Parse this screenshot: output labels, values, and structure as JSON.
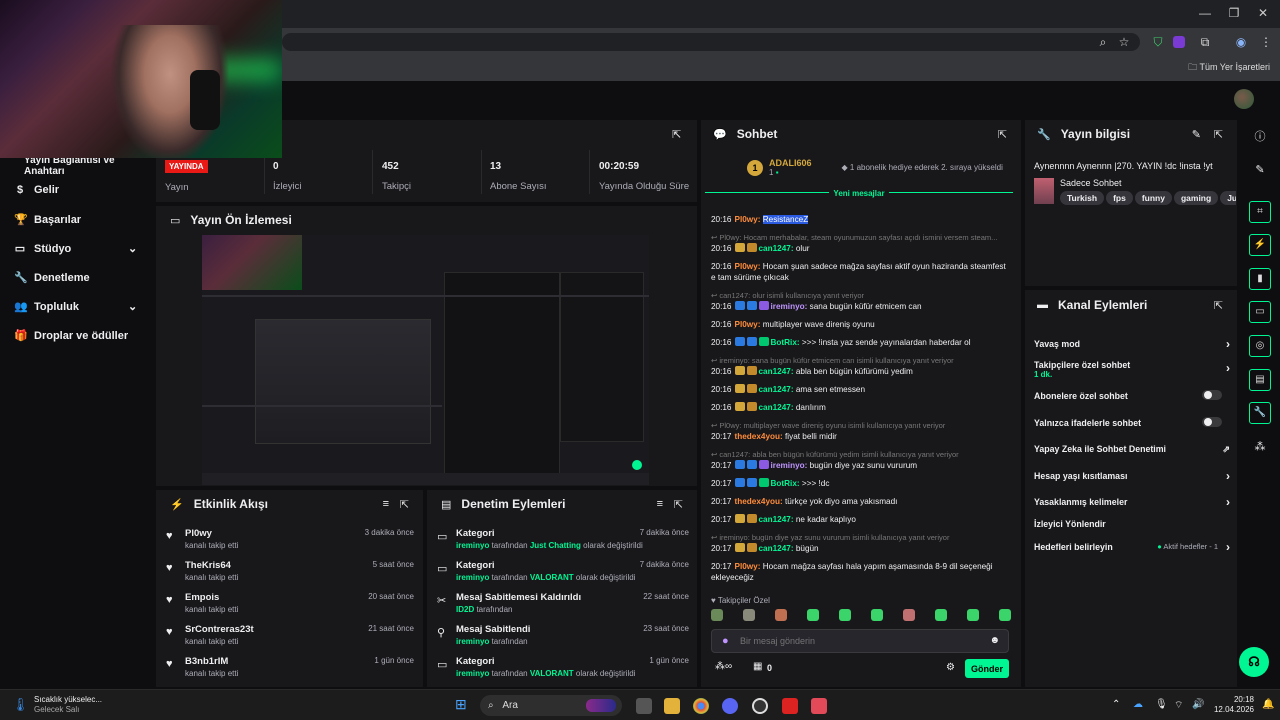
{
  "browser": {
    "bookmarks_label": "Tüm Yer İşaretleri"
  },
  "sidebar": {
    "partial_title": "Yayın Bağlantısı ve Anahtarı",
    "items": [
      {
        "label": "Gelir",
        "icon": "dollar-icon"
      },
      {
        "label": "Başarılar",
        "icon": "trophy-icon"
      },
      {
        "label": "Stüdyo",
        "icon": "studio-icon"
      },
      {
        "label": "Denetleme",
        "icon": "wrench-icon"
      },
      {
        "label": "Topluluk",
        "icon": "users-icon"
      },
      {
        "label": "Droplar ve ödüller",
        "icon": "gift-icon"
      }
    ]
  },
  "stats": {
    "live_badge": "YAYINDA",
    "live_label": "Yayın",
    "viewers_value": "0",
    "viewers_label": "İzleyici",
    "followers_value": "452",
    "followers_label": "Takipçi",
    "subs_value": "13",
    "subs_label": "Abone Sayısı",
    "uptime_value": "00:20:59",
    "uptime_label": "Yayında Olduğu Süre"
  },
  "preview": {
    "title": "Yayın Ön İzlemesi"
  },
  "activity": {
    "title": "Etkinlik Akışı",
    "items": [
      {
        "name": "Pl0wy",
        "sub": "kanalı takip etti",
        "time": "3 dakika önce"
      },
      {
        "name": "TheKris64",
        "sub": "kanalı takip etti",
        "time": "5 saat önce"
      },
      {
        "name": "Empois",
        "sub": "kanalı takip etti",
        "time": "20 saat önce"
      },
      {
        "name": "SrContreras23t",
        "sub": "kanalı takip etti",
        "time": "21 saat önce"
      },
      {
        "name": "B3nb1rIM",
        "sub": "kanalı takip etti",
        "time": "1 gün önce"
      }
    ]
  },
  "moderation": {
    "title": "Denetim Eylemleri",
    "items": [
      {
        "name": "Kategori",
        "user": "ireminyo",
        "mid": " tarafından ",
        "hl": "Just Chatting",
        "end": " olarak değiştirildi",
        "time": "7 dakika önce"
      },
      {
        "name": "Kategori",
        "user": "ireminyo",
        "mid": " tarafından ",
        "hl": "VALORANT",
        "end": " olarak değiştirildi",
        "time": "7 dakika önce"
      },
      {
        "name": "Mesaj Sabitlemesi Kaldırıldı",
        "user": "ID2D",
        "mid": " tarafından",
        "hl": "",
        "end": "",
        "time": "22 saat önce"
      },
      {
        "name": "Mesaj Sabitlendi",
        "user": "ireminyo",
        "mid": " tarafından",
        "hl": "",
        "end": "",
        "time": "23 saat önce"
      },
      {
        "name": "Kategori",
        "user": "ireminyo",
        "mid": " tarafından ",
        "hl": "VALORANT",
        "end": " olarak değiştirildi",
        "time": "1 gün önce"
      }
    ]
  },
  "chat": {
    "title": "Sohbet",
    "hype_user": "ADALI606",
    "hype_level": "1",
    "hype_count": "1",
    "hype_text": "1 abonelik hediye ederek 2. sıraya yükseldi",
    "new_messages": "Yeni mesajlar",
    "followers_only": "Takipçiler Özel",
    "input_placeholder": "Bir mesaj gönderin",
    "points": "0",
    "send": "Gönder",
    "messages": [
      {
        "reply": "",
        "ts": "20:16",
        "user": "Pl0wy",
        "color": "#ff8c3a",
        "badges": [],
        "text": "",
        "hl": "ResistanceZ"
      },
      {
        "reply": "Pl0wy: Hocam merhabalar, steam oyunumuzun sayfası açıdı ismini versem steam...",
        "ts": "20:16",
        "user": "can1247",
        "color": "#00f593",
        "badges": [
          "#d4a73a",
          "#c28a2a"
        ],
        "text": "olur"
      },
      {
        "reply": "",
        "ts": "20:16",
        "user": "Pl0wy",
        "color": "#ff8c3a",
        "badges": [],
        "text": "Hocam şuan sadece mağza sayfası aktif oyun haziranda steamfest e tam sürüme çıkıcak"
      },
      {
        "reply": "can1247: olur isimli kullanıcıya yanıt veriyor",
        "ts": "20:16",
        "user": "ireminyo",
        "color": "#bf94ff",
        "badges": [
          "#2a7ae2",
          "#2a7ae2",
          "#8a5ae2"
        ],
        "text": "sana bugün küfür etmicem can"
      },
      {
        "reply": "",
        "ts": "20:16",
        "user": "Pl0wy",
        "color": "#ff8c3a",
        "badges": [],
        "text": "multiplayer wave direniş oyunu"
      },
      {
        "reply": "",
        "ts": "20:16",
        "user": "BotRix",
        "color": "#00f593",
        "badges": [
          "#2a7ae2",
          "#2a7ae2",
          "#00c86e"
        ],
        "text": ">>> !insta yaz sende yayınalardan haberdar ol"
      },
      {
        "reply": "ireminyo: sana bugün küfür etmicem can isimli kullanıcıya yanıt veriyor",
        "ts": "20:16",
        "user": "can1247",
        "color": "#00f593",
        "badges": [
          "#d4a73a",
          "#c28a2a"
        ],
        "text": "abla ben bügün küfürümü yedim"
      },
      {
        "reply": "",
        "ts": "20:16",
        "user": "can1247",
        "color": "#00f593",
        "badges": [
          "#d4a73a",
          "#c28a2a"
        ],
        "text": "ama sen etmessen"
      },
      {
        "reply": "",
        "ts": "20:16",
        "user": "can1247",
        "color": "#00f593",
        "badges": [
          "#d4a73a",
          "#c28a2a"
        ],
        "text": "darılırım"
      },
      {
        "reply": "Pl0wy: multiplayer wave direniş oyunu isimli kullanıcıya yanıt veriyor",
        "ts": "20:17",
        "user": "thedex4you",
        "color": "#ff8c3a",
        "badges": [],
        "text": "fiyat belli midir"
      },
      {
        "reply": "can1247: abla ben bügün küfürümü yedim isimli kullanıcıya yanıt veriyor",
        "ts": "20:17",
        "user": "ireminyo",
        "color": "#bf94ff",
        "badges": [
          "#2a7ae2",
          "#2a7ae2",
          "#8a5ae2"
        ],
        "text": "bugün diye yaz sunu vururum"
      },
      {
        "reply": "",
        "ts": "20:17",
        "user": "BotRix",
        "color": "#00f593",
        "badges": [
          "#2a7ae2",
          "#2a7ae2",
          "#00c86e"
        ],
        "text": ">>> !dc"
      },
      {
        "reply": "",
        "ts": "20:17",
        "user": "thedex4you",
        "color": "#ff8c3a",
        "badges": [],
        "text": "türkçe yok diyo ama yakısmadı"
      },
      {
        "reply": "",
        "ts": "20:17",
        "user": "can1247",
        "color": "#00f593",
        "badges": [
          "#d4a73a",
          "#c28a2a"
        ],
        "text": "ne kadar kaplıyo"
      },
      {
        "reply": "ireminyo: bugün diye yaz sunu vururum isimli kullanıcıya yanıt veriyor",
        "ts": "20:17",
        "user": "can1247",
        "color": "#00f593",
        "badges": [
          "#d4a73a",
          "#c28a2a"
        ],
        "text": "bügün"
      },
      {
        "reply": "",
        "ts": "20:17",
        "user": "Pl0wy",
        "color": "#ff8c3a",
        "badges": [],
        "text": "Hocam mağza sayfası hala yapım aşamasında 8-9 dil seçeneği ekleyeceğiz"
      }
    ]
  },
  "stream_info": {
    "title": "Yayın bilgisi",
    "stream_title": "Aynennnn Aynennn |270. YAYIN !dc !insta !yt",
    "category": "Sadece Sohbet",
    "tags": [
      "Turkish",
      "fps",
      "funny",
      "gaming",
      "Just"
    ]
  },
  "channel_actions": {
    "title": "Kanal Eylemleri",
    "items": [
      {
        "label": "Yavaş mod",
        "kind": "chevron"
      },
      {
        "label": "Takipçilere özel sohbet",
        "kind": "chevron",
        "sub": "1 dk."
      },
      {
        "label": "Abonelere özel sohbet",
        "kind": "toggle"
      },
      {
        "label": "Yalnızca ifadelerle sohbet",
        "kind": "toggle"
      },
      {
        "label": "Yapay Zeka ile Sohbet Denetimi",
        "kind": "external"
      },
      {
        "label": "Hesap yaşı kısıtlaması",
        "kind": "chevron"
      },
      {
        "label": "Yasaklanmış kelimeler",
        "kind": "chevron"
      },
      {
        "label": "İzleyici Yönlendir",
        "kind": "none"
      },
      {
        "label": "Hedefleri belirleyin",
        "kind": "chevron",
        "extra": "Aktif hedefler - 1"
      }
    ]
  },
  "taskbar": {
    "weather_line1": "Sıcaklık yükselec...",
    "weather_line2": "Gelecek Salı",
    "search": "Ara",
    "time": "20:18",
    "date": "12.04.2026"
  },
  "colors": {
    "accent": "#00f593",
    "live": "#e91916",
    "panel": "#18181b",
    "bg": "#0e0e10"
  }
}
